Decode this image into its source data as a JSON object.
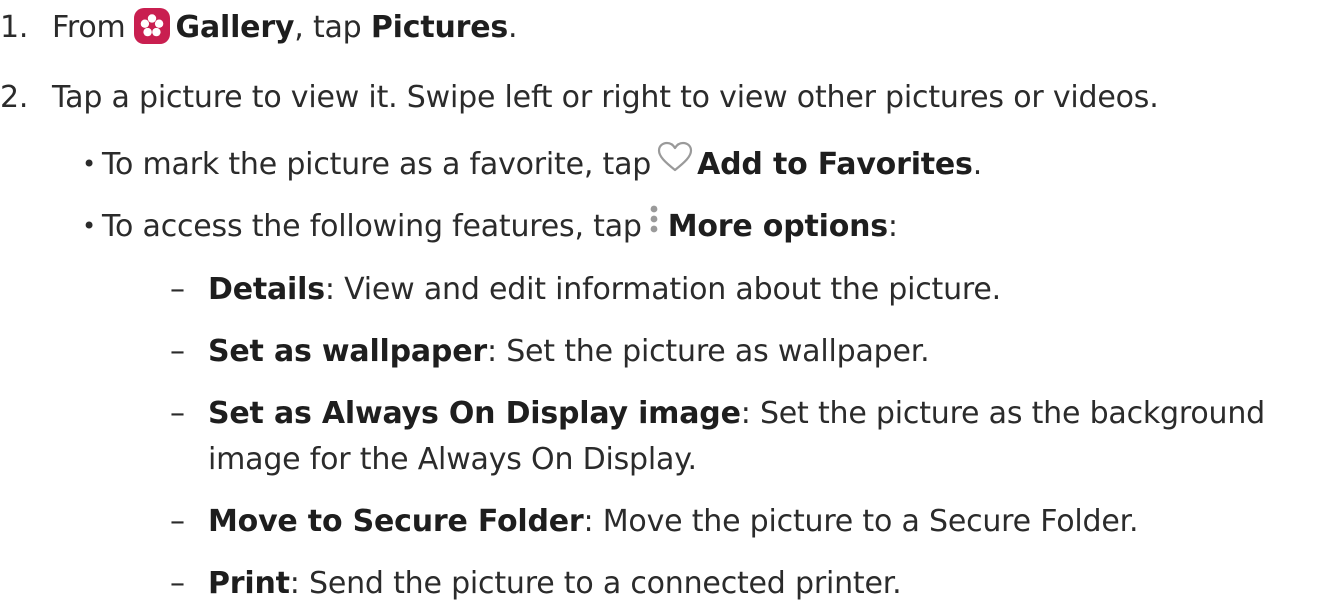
{
  "step1": {
    "number": "1.",
    "from": "From",
    "gallery": "Gallery",
    "tap": ", tap",
    "pictures": "Pictures",
    "period": "."
  },
  "step2": {
    "number": "2.",
    "text": "Tap a picture to view it. Swipe left or right to view other pictures or videos."
  },
  "bullet1": {
    "pre": "To mark the picture as a favorite, tap",
    "action": "Add to Favorites",
    "post": "."
  },
  "bullet2": {
    "pre": "To access the following features, tap",
    "action": "More options",
    "post": ":"
  },
  "options": [
    {
      "name": "Details",
      "desc": ": View and edit information about the picture."
    },
    {
      "name": "Set as wallpaper",
      "desc": ": Set the picture as wallpaper."
    },
    {
      "name": "Set as Always On Display image",
      "desc": ": Set the picture as the background",
      "cont": "image for the Always On Display."
    },
    {
      "name": "Move to Secure Folder",
      "desc": ": Move the picture to a Secure Folder."
    },
    {
      "name": "Print",
      "desc": ": Send the picture to a connected printer."
    }
  ],
  "bullet_char": "•",
  "dash_char": "–",
  "icons": {
    "gallery": "gallery-app-icon",
    "favorite": "heart-outline-icon",
    "more": "more-options-vertical-dots-icon"
  },
  "colors": {
    "gallery_icon_bg": "#c91f50",
    "text": "#2b2b2b",
    "icon_gray": "#9a9a9a"
  }
}
